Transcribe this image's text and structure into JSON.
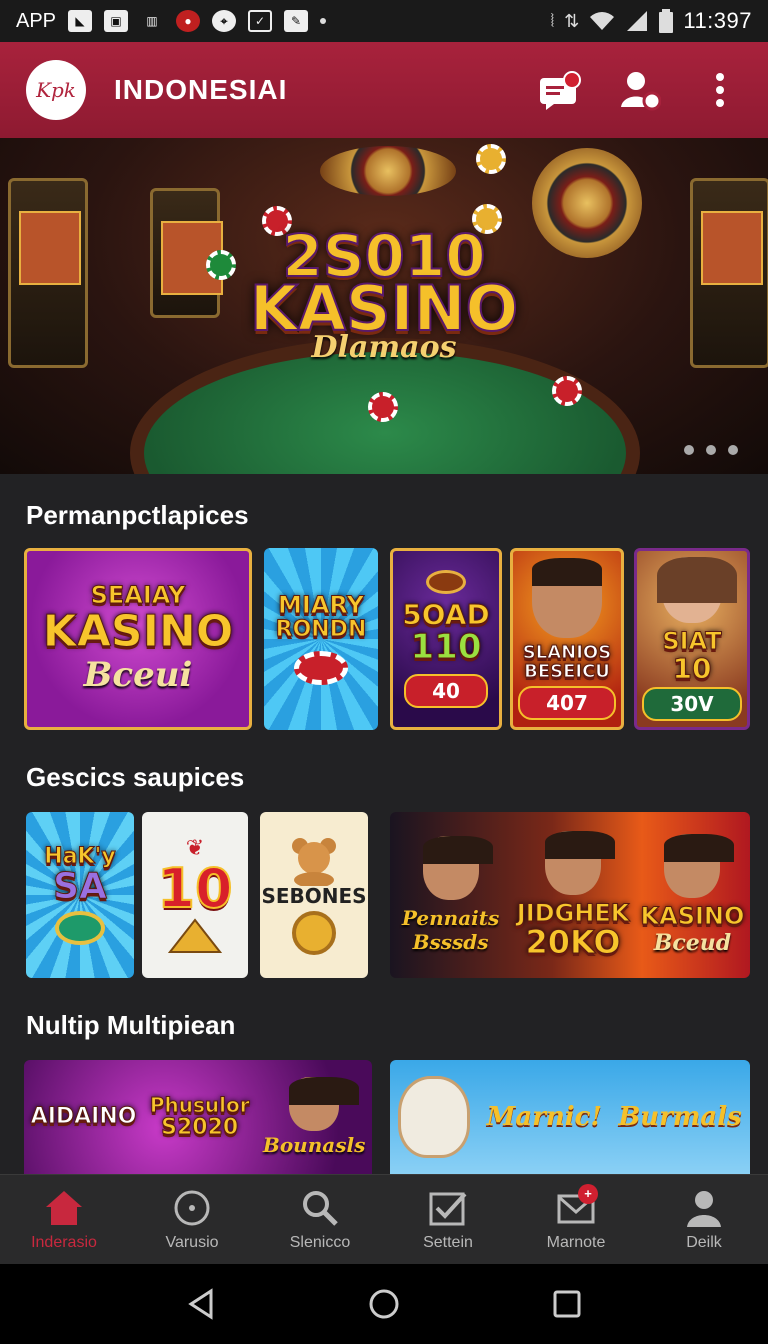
{
  "status_bar": {
    "app_label": "APP",
    "icons": [
      "image-icon",
      "photo-icon",
      "bank-icon",
      "record-icon",
      "location-icon",
      "check-icon",
      "edit-icon"
    ],
    "status_icons": [
      "vibrate-icon",
      "data-icon",
      "wifi-icon",
      "signal-icon",
      "battery-icon"
    ],
    "time": "11:397"
  },
  "app_bar": {
    "logo_text": "Kpk",
    "title": "INDONESIAI",
    "actions": [
      "chat-gift-icon",
      "profile-settings-icon",
      "more-vert-icon"
    ]
  },
  "hero": {
    "badge": "2S010",
    "title": "KASINO",
    "subtitle": "Dlamaos",
    "page_indicator_count": 3
  },
  "sections": [
    {
      "title": "Permanpctlapices",
      "cards": [
        {
          "line1": "SEAIAY",
          "line2": "KASINO",
          "script": "Bceui"
        },
        {
          "line1": "MIARY",
          "line2": "RONDN"
        },
        {
          "line1": "5OAD",
          "line2": "110",
          "pill": "40"
        },
        {
          "line1": "SLANIOS",
          "line2": "BESEICU",
          "pill": "407"
        },
        {
          "line1": "SIAT",
          "line2": "10",
          "pill": "30V"
        }
      ]
    },
    {
      "title": "Gescics saupices",
      "cards": [
        {
          "line1": "HaK'y",
          "line2": "SA"
        },
        {
          "line1": "10"
        },
        {
          "line1": "SEBONES"
        },
        {
          "col1_script": "Pennaits Bsssds",
          "col2": "JIDGHEK",
          "col2_sub": "20KO",
          "col3": "KASINO",
          "col3_script": "Bceud"
        }
      ]
    },
    {
      "title": "Nultip Multipiean",
      "cards": [
        {
          "line1": "AIDAINO",
          "line2": "Phusulor",
          "line3": "S2020",
          "script": "Bounasls"
        },
        {
          "script1": "Marnic!",
          "script2": "Burmals"
        }
      ]
    }
  ],
  "bottom_nav": [
    {
      "label": "Inderasio",
      "icon": "home-icon",
      "active": true
    },
    {
      "label": "Varusio",
      "icon": "circle-dot-icon",
      "active": false
    },
    {
      "label": "Slenicco",
      "icon": "search-icon",
      "active": false
    },
    {
      "label": "Settein",
      "icon": "checkbox-icon",
      "active": false
    },
    {
      "label": "Marnote",
      "icon": "mail-icon",
      "active": false,
      "badge": "+"
    },
    {
      "label": "Deilk",
      "icon": "person-icon",
      "active": false
    }
  ],
  "system_nav": [
    "back-icon",
    "home-circle-icon",
    "recents-icon"
  ],
  "colors": {
    "accent": "#a8223c",
    "active_nav": "#c8283e",
    "background": "#222224"
  }
}
